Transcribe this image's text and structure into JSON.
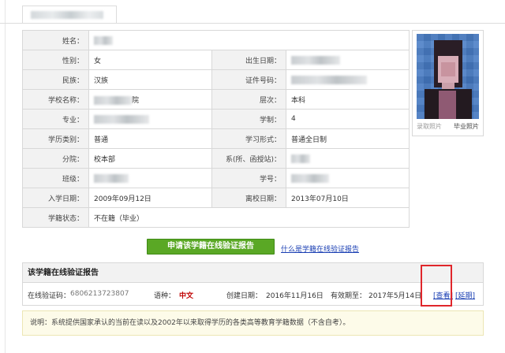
{
  "tab": {
    "label": ""
  },
  "info": {
    "rows": [
      {
        "l1": "姓名：",
        "v1": "",
        "l2": "",
        "v2": ""
      },
      {
        "l1": "性别：",
        "v1": "女",
        "l2": "出生日期：",
        "v2": ""
      },
      {
        "l1": "民族：",
        "v1": "汉族",
        "l2": "证件号码：",
        "v2": ""
      },
      {
        "l1": "学校名称：",
        "v1": "院",
        "l2": "层次：",
        "v2": "本科"
      },
      {
        "l1": "专业：",
        "v1": "",
        "l2": "学制：",
        "v2": "4"
      },
      {
        "l1": "学历类别：",
        "v1": "普通",
        "l2": "学习形式：",
        "v2": "普通全日制"
      },
      {
        "l1": "分院：",
        "v1": "校本部",
        "l2": "系(所、函授站)：",
        "v2": ""
      },
      {
        "l1": "班级：",
        "v1": "",
        "l2": "学号：",
        "v2": ""
      },
      {
        "l1": "入学日期：",
        "v1": "2009年09月12日",
        "l2": "离校日期：",
        "v2": "2013年07月10日"
      },
      {
        "l1": "学籍状态：",
        "v1": "不在籍（毕业）",
        "l2": "",
        "v2": ""
      }
    ]
  },
  "photo": {
    "caption_left": "录取照片",
    "caption_right": "毕业照片"
  },
  "actions": {
    "apply_label": "申请该学籍在线验证报告",
    "what_link": "什么是学籍在线验证报告"
  },
  "report": {
    "title": "该学籍在线验证报告",
    "code_label": "在线验证码：",
    "code_value": "6806213723807",
    "lang_label": "语种：",
    "lang_value": "中文",
    "created_label": "创建日期：",
    "created_value": "2016年11月16日",
    "valid_label": "有效期至：",
    "valid_value": "2017年5月14日",
    "view_link": "[查看]",
    "renew_link": "[延期]"
  },
  "note": "说明：系统提供国家承认的当前在读以及2002年以来取得学历的各类高等教育学籍数据（不含自考）。"
}
